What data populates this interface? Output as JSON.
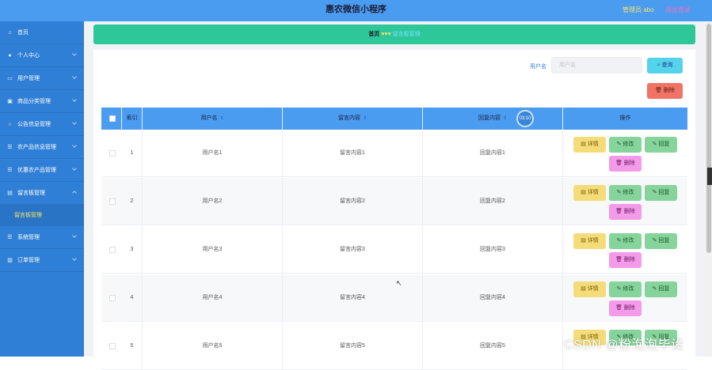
{
  "header": {
    "title": "惠农微信小程序",
    "admin": "管理员 abo",
    "logout": "退出登录"
  },
  "sidebar": {
    "items": [
      {
        "label": "首页",
        "icon": "home-icon"
      },
      {
        "label": "个人中心",
        "icon": "user-icon"
      },
      {
        "label": "用户管理",
        "icon": "users-icon"
      },
      {
        "label": "商品分类管理",
        "icon": "category-icon"
      },
      {
        "label": "公告信息管理",
        "icon": "notice-icon"
      },
      {
        "label": "农产品信息管理",
        "icon": "list-icon"
      },
      {
        "label": "优惠农产品管理",
        "icon": "list-icon"
      },
      {
        "label": "留言板管理",
        "icon": "message-icon"
      },
      {
        "label": "系统管理",
        "icon": "settings-icon"
      },
      {
        "label": "订单管理",
        "icon": "order-icon"
      }
    ],
    "active_sub": "留言板管理"
  },
  "breadcrumb": {
    "home": "首页",
    "separator": "♥♥♥",
    "current": "留言板管理"
  },
  "search": {
    "label": "用户名",
    "placeholder": "用户名",
    "button": "查询"
  },
  "toolbar": {
    "delete": "删除"
  },
  "table": {
    "headers": {
      "index": "索引",
      "username": "用户名",
      "message": "留言内容",
      "reply": "回复内容",
      "actions": "操作"
    },
    "timer": "03:10",
    "rows": [
      {
        "index": "1",
        "username": "用户名1",
        "message": "留言内容1",
        "reply": "回复内容1"
      },
      {
        "index": "2",
        "username": "用户名2",
        "message": "留言内容2",
        "reply": "回复内容2"
      },
      {
        "index": "3",
        "username": "用户名3",
        "message": "留言内容3",
        "reply": "回复内容3"
      },
      {
        "index": "4",
        "username": "用户名4",
        "message": "留言内容4",
        "reply": "回复内容4"
      },
      {
        "index": "5",
        "username": "用户名5",
        "message": "留言内容5",
        "reply": "回复内容5"
      }
    ],
    "actions": {
      "detail": "详情",
      "edit": "修改",
      "reply": "回复",
      "delete": "删除"
    }
  },
  "watermark": "CSDN @粉泡泡毕设"
}
